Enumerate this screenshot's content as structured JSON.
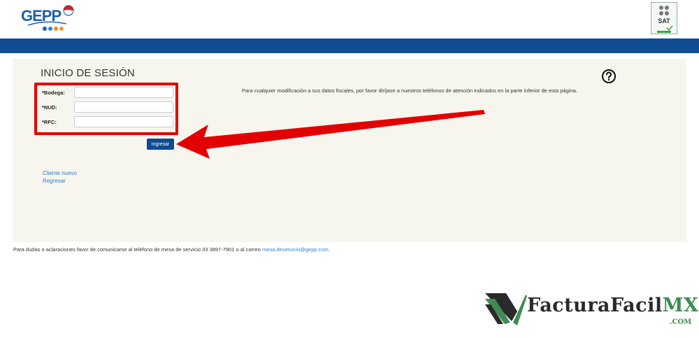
{
  "header": {
    "logo_left": "GEPP",
    "logo_right": "SAT"
  },
  "login": {
    "title": "INICIO DE SESIÓN",
    "notice": "Para cualquier modificación a sus datos fiscales, por favor diríjase a nuestros teléfonos de atención indicados en la parte inferior de esta página.",
    "fields": [
      {
        "label": "*Bodega:",
        "value": "",
        "placeholder": ""
      },
      {
        "label": "*NUD:",
        "value": "",
        "placeholder": ""
      },
      {
        "label": "*RFC:",
        "value": "",
        "placeholder": ""
      }
    ],
    "submit_label": "Ingresar",
    "links": {
      "new_client": "Cliente nuevo",
      "back": "Regresar"
    },
    "help_icon": "help-circle-icon"
  },
  "footer": {
    "text": "Para dudas o aclaraciones favor de comunicarse al teléfono de mesa de servicio 33 3897-7901 o al correo",
    "email": "mesa.deservicio@gepp.com",
    "period": "."
  },
  "watermark": {
    "name_main": "FacturaFacil",
    "name_suffix": "MX",
    "domain": ".COM"
  },
  "colors": {
    "brand_blue": "#0f4c92",
    "highlight_red": "#e30000",
    "link_blue": "#2f7fce",
    "panel_bg": "#f6f6ef"
  }
}
